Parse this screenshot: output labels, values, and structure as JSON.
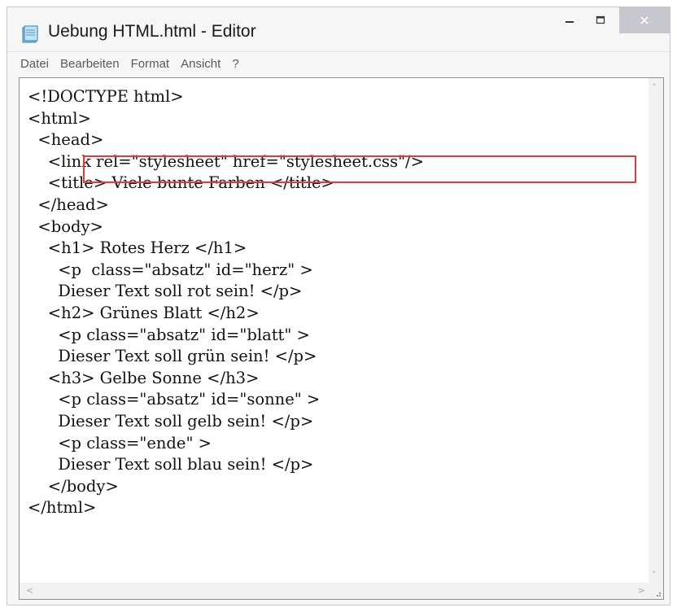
{
  "window": {
    "title": "Uebung HTML.html - Editor",
    "icon": "notepad-icon",
    "controls": {
      "minimize_icon": "minimize-icon",
      "maximize_icon": "maximize-icon",
      "close_icon": "close-icon"
    }
  },
  "menu": {
    "items": [
      "Datei",
      "Bearbeiten",
      "Format",
      "Ansicht",
      "?"
    ]
  },
  "editor": {
    "lines": [
      "<!DOCTYPE html>",
      "<html>",
      "  <head>",
      "    <link rel=\"stylesheet\" href=\"stylesheet.css\"/>",
      "    <title> Viele bunte Farben </title>",
      "  </head>",
      "  <body>",
      "    <h1> Rotes Herz </h1>",
      "      <p  class=\"absatz\" id=\"herz\" >",
      "      Dieser Text soll rot sein! </p>",
      "    <h2> Grünes Blatt </h2>",
      "      <p class=\"absatz\" id=\"blatt\" >",
      "      Dieser Text soll grün sein! </p>",
      "    <h3> Gelbe Sonne </h3>",
      "      <p class=\"absatz\" id=\"sonne\" >",
      "      Dieser Text soll gelb sein! </p>",
      "      <p class=\"ende\" >",
      "      Dieser Text soll blau sein! </p>",
      "    </body>",
      "</html>"
    ],
    "highlight_color": "#e23a3a"
  },
  "scrollbars": {
    "up_arrow": "˄",
    "down_arrow": "˅",
    "left_arrow": "<",
    "right_arrow": ">"
  }
}
